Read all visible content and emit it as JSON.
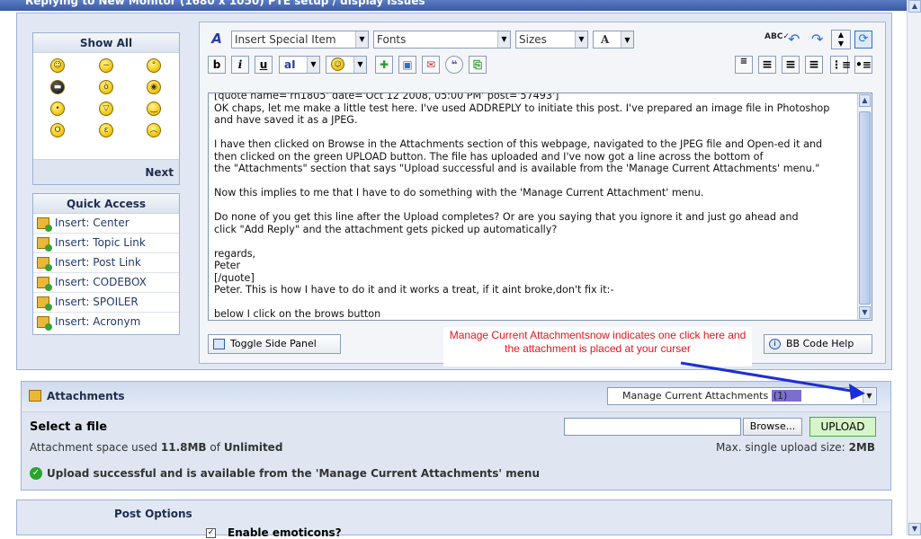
{
  "window": {
    "title": "Replying to New Monitor (1680 x 1050) PTE setup / display issues"
  },
  "smilies": {
    "header": "Show All",
    "next": "Next",
    "items": [
      {
        "glyph": "◕‿◕"
      },
      {
        "glyph": "-_-"
      },
      {
        "glyph": "o_o"
      },
      {
        "glyph": "▪_▪"
      },
      {
        "glyph": "ò_ó"
      },
      {
        "glyph": "◉_◉"
      },
      {
        "glyph": "•ᴗ•"
      },
      {
        "glyph": "^▽^"
      },
      {
        "glyph": "•‿•"
      },
      {
        "glyph": "O_O"
      },
      {
        "glyph": "•ε•"
      },
      {
        "glyph": "•︵•"
      }
    ]
  },
  "quick_access": {
    "header": "Quick Access",
    "items": [
      "Insert: Center",
      "Insert: Topic Link",
      "Insert: Post Link",
      "Insert: CODEBOX",
      "Insert: SPOILER",
      "Insert: Acronym"
    ]
  },
  "toolbar": {
    "special_item": "Insert Special Item",
    "fonts": "Fonts",
    "sizes": "Sizes",
    "color_glyph": "A",
    "bold": "b",
    "italic": "i",
    "underline": "u",
    "fontstyle": "aI"
  },
  "editor": {
    "content": "[quote name='rh1805' date='Oct 12 2008, 05:00 PM' post='57493']\nOK chaps, let me make a little test here. I've used ADDREPLY to initiate this post. I've prepared an image file in Photoshop\nand have saved it as a JPEG.\n\nI have then clicked on Browse in the Attachments section of this webpage, navigated to the JPEG file and Open-ed it and\nthen clicked on the green UPLOAD button. The file has uploaded and I've now got a line across the bottom of\nthe \"Attachments\" section that says \"Upload successful and is available from the 'Manage Current Attachments' menu.\"\n\nNow this implies to me that I have to do something with the 'Manage Current Attachment' menu.\n\nDo none of you get this line after the Upload completes? Or are you saying that you ignore it and just go ahead and\nclick \"Add Reply\" and the attachment gets picked up automatically?\n\nregards,\nPeter\n[/quote]\nPeter. This is how I have to do it and it works a treat, if it aint broke,don't fix it:-\n\nbelow I click on the brows button",
    "toggle_side_panel": "Toggle Side Panel",
    "bb_code_help": "BB Code Help"
  },
  "annotation": {
    "text": "Manage Current Attachmentsnow indicates one click here and the attachment is placed at your curser",
    "color": "#e8121a",
    "arrow_color": "#1a2fd6"
  },
  "attachments": {
    "header": "Attachments",
    "manage_dropdown": "Manage Current Attachments",
    "manage_count": "(1)",
    "select_file_label": "Select a file",
    "browse": "Browse...",
    "upload": "UPLOAD",
    "space_prefix": "Attachment space used",
    "space_used": "11.8MB",
    "space_of": "of",
    "space_total": "Unlimited",
    "max_label": "Max. single upload size:",
    "max_value": "2MB",
    "success": "Upload successful and is available from the 'Manage Current Attachments' menu"
  },
  "post_options": {
    "title": "Post Options",
    "enable_emoticons": "Enable emoticons?"
  }
}
